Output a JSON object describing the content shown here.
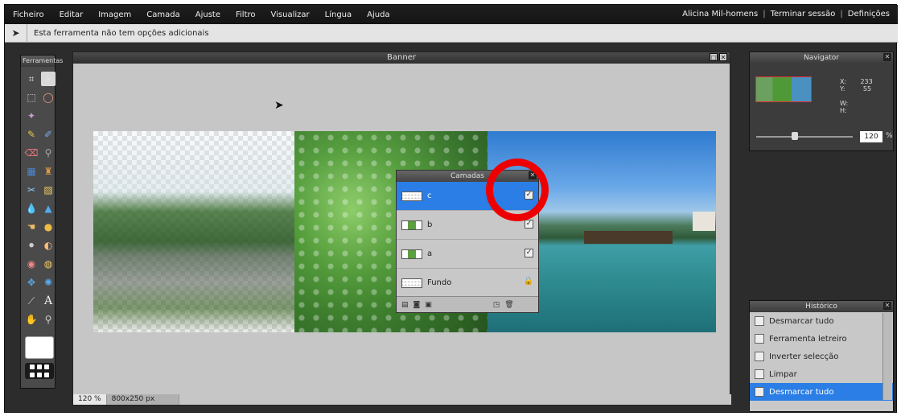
{
  "menu": {
    "items": [
      "Ficheiro",
      "Editar",
      "Imagem",
      "Camada",
      "Ajuste",
      "Filtro",
      "Visualizar",
      "Língua",
      "Ajuda"
    ],
    "user": "Alicina Mil-homens",
    "logout": "Terminar sessão",
    "settings": "Definições"
  },
  "options": {
    "text": "Esta ferramenta não tem opções adicionais"
  },
  "tools": {
    "title": "Ferramentas"
  },
  "document": {
    "title": "Banner",
    "zoom": "120 %",
    "size": "800x250 px"
  },
  "layers": {
    "title": "Camadas",
    "items": [
      {
        "name": "c",
        "visible": true,
        "selected": true
      },
      {
        "name": "b",
        "visible": true,
        "selected": false
      },
      {
        "name": "a",
        "visible": true,
        "selected": false
      },
      {
        "name": "Fundo",
        "locked": true,
        "selected": false
      }
    ]
  },
  "navigator": {
    "title": "Navigator",
    "x_label": "X:",
    "x_value": "233",
    "y_label": "Y:",
    "y_value": "55",
    "w_label": "W:",
    "h_label": "H:",
    "zoom": "120",
    "zoom_unit": "%"
  },
  "history": {
    "title": "Histórico",
    "items": [
      {
        "label": "Desmarcar tudo",
        "selected": false
      },
      {
        "label": "Ferramenta letreiro",
        "selected": false
      },
      {
        "label": "Inverter selecção",
        "selected": false
      },
      {
        "label": "Limpar",
        "selected": false
      },
      {
        "label": "Desmarcar tudo",
        "selected": true
      }
    ]
  },
  "colors": {
    "selection": "#2a7ee6",
    "highlight_ring": "#e00000"
  }
}
